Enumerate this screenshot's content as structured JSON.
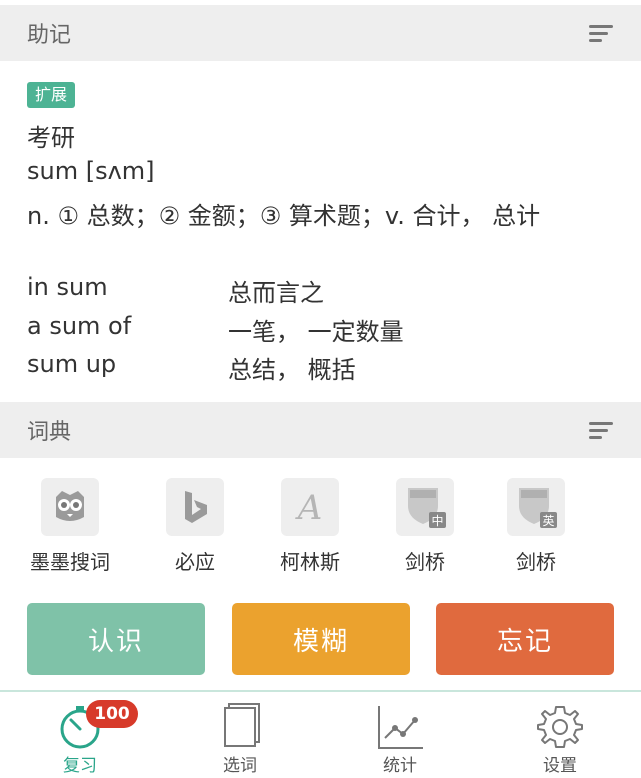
{
  "mnemonic": {
    "header_title": "助记",
    "tag": "扩展",
    "category": "考研",
    "word_line": "sum [sʌm]",
    "definition": "n. ① 总数；② 金额；③ 算术题；v. 合计， 总计",
    "phrases": [
      {
        "en": "in sum",
        "zh": "总而言之"
      },
      {
        "en": "a sum of",
        "zh": "一笔， 一定数量"
      },
      {
        "en": "sum up",
        "zh": "总结， 概括"
      }
    ]
  },
  "dictionary": {
    "header_title": "词典",
    "items": [
      {
        "label": "墨墨搜词",
        "icon": "owl-icon"
      },
      {
        "label": "必应",
        "icon": "bing-icon"
      },
      {
        "label": "柯林斯",
        "icon": "collins-icon"
      },
      {
        "label": "剑桥",
        "icon": "cambridge-zh-icon",
        "sub": "中"
      },
      {
        "label": "剑桥",
        "icon": "cambridge-en-icon",
        "sub": "英"
      }
    ]
  },
  "actions": {
    "know": {
      "label": "认识",
      "color": "#7fc2a8"
    },
    "vague": {
      "label": "模糊",
      "color": "#eba22e"
    },
    "forget": {
      "label": "忘记",
      "color": "#e06a3e"
    }
  },
  "tabs": {
    "review": {
      "label": "复习",
      "badge": "100",
      "color": "#2aa58a"
    },
    "select": {
      "label": "选词"
    },
    "stats": {
      "label": "统计"
    },
    "settings": {
      "label": "设置"
    }
  }
}
